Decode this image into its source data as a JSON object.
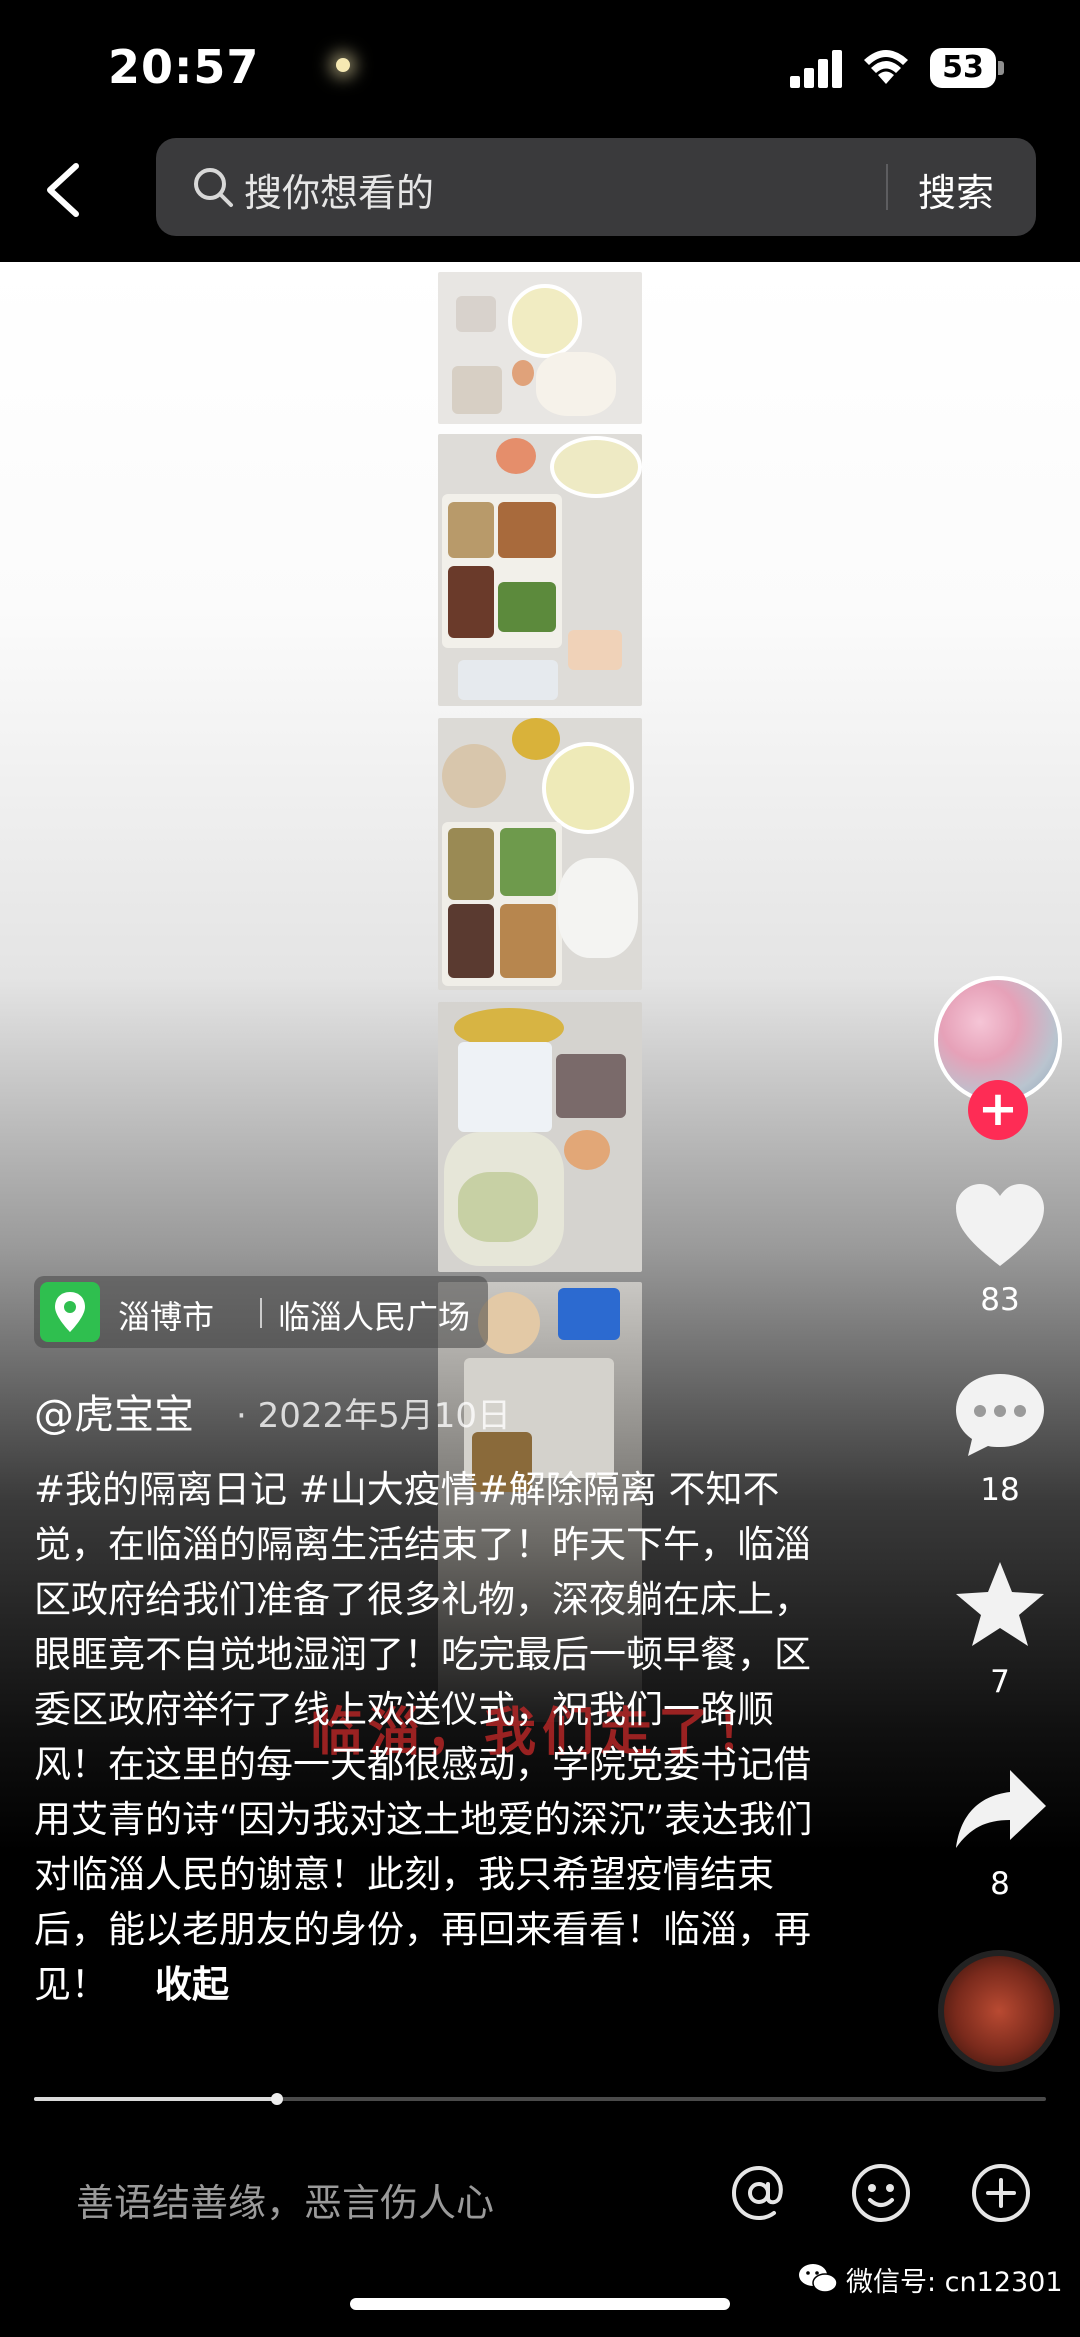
{
  "status_bar": {
    "time": "20:57",
    "battery": "53"
  },
  "search": {
    "placeholder": "搜你想看的",
    "submit_label": "搜索"
  },
  "video": {
    "overlay_text": "临淄，我们走了！"
  },
  "actions": {
    "likes": "83",
    "comments": "18",
    "favorites": "7",
    "shares": "8"
  },
  "location": {
    "city": "淄博市",
    "place": "临淄人民广场"
  },
  "post": {
    "username": "@虎宝宝",
    "date": "· 2022年5月10日",
    "caption": "#我的隔离日记 #山大疫情#解除隔离 不知不觉，在临淄的隔离生活结束了！昨天下午，临淄区政府给我们准备了很多礼物，深夜躺在床上，眼眶竟不自觉地湿润了！吃完最后一顿早餐，区委区政府举行了线上欢送仪式，祝我们一路顺风！在这里的每一天都很感动，学院党委书记借用艾青的诗“因为我对这土地爱的深沉”表达我们对临淄人民的谢意！此刻，我只希望疫情结束后，能以老朋友的身份，再回来看看！临淄，再见！",
    "collapse_label": "收起"
  },
  "progress": {
    "fraction": 0.24
  },
  "comment_bar": {
    "placeholder": "善语结善缘，恶言伤人心"
  },
  "watermark": "微信号: cn12301",
  "colors": {
    "accent": "#fe2c55",
    "location_green": "#2fbf4f"
  }
}
